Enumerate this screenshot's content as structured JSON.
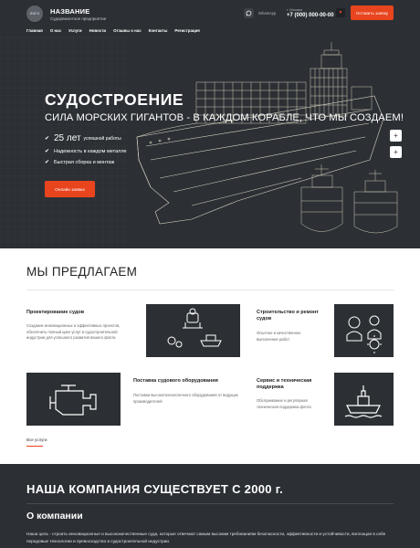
{
  "header": {
    "logo_text": "ЛОГО",
    "brand_name": "НАЗВАНИЕ",
    "brand_tagline": "Судоремонтное предприятие",
    "whatsapp_label": "WhatsApp",
    "phone_city": "г. Москва",
    "phone_number": "+7 (000) 000-00-00",
    "order_button": "Оставить заявку"
  },
  "nav": [
    "Главная",
    "О нас",
    "Услуги",
    "Новости",
    "Отзывы о нас",
    "Контакты",
    "Регистрация"
  ],
  "hero": {
    "title": "СУДОСТРОЕНИЕ",
    "subtitle": "СИЛА МОРСКИХ ГИГАНТОВ - В КАЖДОМ КОРАБЛЕ, ЧТО МЫ СОЗДАЕМ!",
    "bullet1_big": "25 лет",
    "bullet1_small": "успешной работы",
    "bullet2": "Надежность в каждом металле",
    "bullet3": "Быстрая сборка и монтаж",
    "cta": "Онлайн заявка",
    "zoom_in": "+",
    "zoom_out": "+"
  },
  "offer": {
    "title": "МЫ ПРЕДЛАГАЕМ",
    "services": [
      {
        "title": "Проектирование судов",
        "desc": "Создание инновационных и эффективных проектов, обеспечить полный цикл услуг в судостроительной индустрии для успешного развития вашего флота"
      },
      {
        "title": "Строительство и ремонт судов",
        "desc": "Опытное и качественное выполнение работ"
      },
      {
        "title": "Поставка судового оборудования",
        "desc": "Поставки высокотехнологичного оборудования от ведущих производителей"
      },
      {
        "title": "Сервис и техническая поддержка",
        "desc": "Обслуживание и регулярная техническая поддержка флота"
      }
    ],
    "all_link": "Все услуги"
  },
  "about": {
    "heading": "НАША КОМПАНИЯ СУЩЕСТВУЕТ С 2000 г.",
    "subheading": "О компании",
    "text": "Наша цель - строить инновационные и высококачественные суда, которые отвечают самым высоким требованиям безопасности, эффективности и устойчивости, воплощая в себе передовые технологии и превосходство в судостроительной индустрии."
  },
  "colors": {
    "accent": "#e8441d",
    "dark": "#2c3035",
    "white": "#ffffff"
  }
}
